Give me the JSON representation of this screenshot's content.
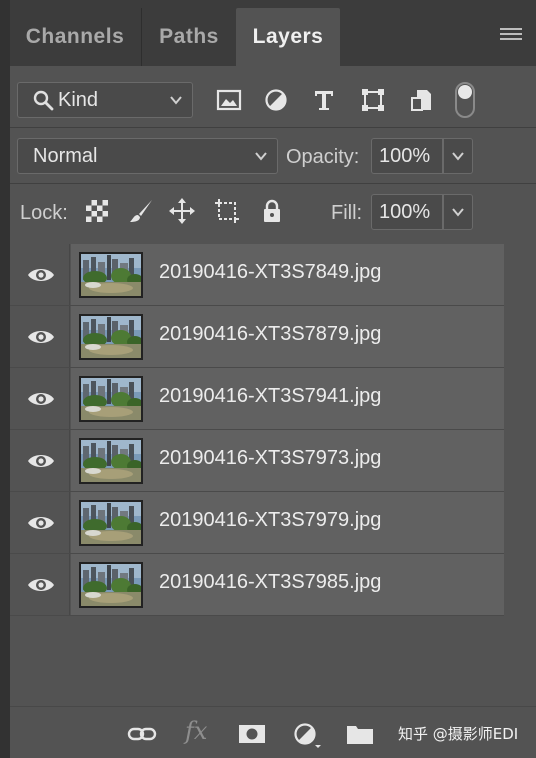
{
  "tabs": [
    {
      "label": "Channels",
      "active": false
    },
    {
      "label": "Paths",
      "active": false
    },
    {
      "label": "Layers",
      "active": true
    }
  ],
  "filter": {
    "kind_label": "Kind",
    "icons": [
      "image-filter-icon",
      "adjustment-filter-icon",
      "type-filter-icon",
      "shape-filter-icon",
      "smart-object-filter-icon"
    ],
    "filter_toggle_on": true
  },
  "blend": {
    "mode": "Normal",
    "opacity_label": "Opacity:",
    "opacity_value": "100%"
  },
  "lock": {
    "label": "Lock:",
    "icons": [
      "lock-transparent-pixels-icon",
      "lock-image-pixels-icon",
      "lock-position-icon",
      "prevent-autonest-icon",
      "lock-all-icon"
    ],
    "fill_label": "Fill:",
    "fill_value": "100%"
  },
  "layers": [
    {
      "name": "20190416-XT3S7849.jpg",
      "visible": true
    },
    {
      "name": "20190416-XT3S7879.jpg",
      "visible": true
    },
    {
      "name": "20190416-XT3S7941.jpg",
      "visible": true
    },
    {
      "name": "20190416-XT3S7973.jpg",
      "visible": true
    },
    {
      "name": "20190416-XT3S7979.jpg",
      "visible": true
    },
    {
      "name": "20190416-XT3S7985.jpg",
      "visible": true
    }
  ],
  "bottom_toolbar": {
    "icons": [
      "link-layers-icon",
      "fx-icon",
      "layer-mask-icon",
      "adjustment-layer-icon",
      "group-folder-icon"
    ],
    "fx_text": "fx"
  },
  "watermark": "知乎 @摄影师EDI",
  "colors": {
    "panel_bg": "#535353",
    "tab_bar_bg": "#3c3c3c",
    "layer_row_bg": "#616161",
    "text": "#ececec"
  }
}
